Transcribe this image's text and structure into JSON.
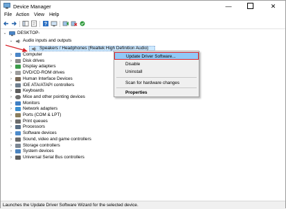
{
  "window": {
    "title": "Device Manager",
    "controls": {
      "minimize": "—",
      "close": "✕"
    }
  },
  "menu": [
    "File",
    "Action",
    "View",
    "Help"
  ],
  "tree": {
    "root": "DESKTOP-",
    "expanded_category": "Audio inputs and outputs",
    "selected_device": "Speakers / Headphones (Realtek High Definition Audio)",
    "categories": [
      "Computer",
      "Disk drives",
      "Display adapters",
      "DVD/CD-ROM drives",
      "Human Interface Devices",
      "IDE ATA/ATAPI controllers",
      "Keyboards",
      "Mice and other pointing devices",
      "Monitors",
      "Network adapters",
      "Ports (COM & LPT)",
      "Print queues",
      "Processors",
      "Software devices",
      "Sound, video and game controllers",
      "Storage controllers",
      "System devices",
      "Universal Serial Bus controllers"
    ]
  },
  "context_menu": {
    "update_driver": "Update Driver Software...",
    "disable": "Disable",
    "uninstall": "Uninstall",
    "scan": "Scan for hardware changes",
    "properties": "Properties"
  },
  "status": {
    "text": "Launches the Update Driver Software Wizard for the selected device."
  },
  "colors": {
    "selection": "#cce8ff",
    "menu_highlight": "#91c9f7",
    "annotation_red": "#d9232a"
  }
}
